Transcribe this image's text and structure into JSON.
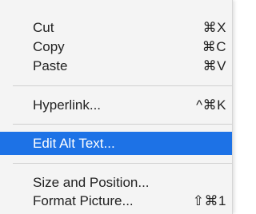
{
  "menu": {
    "items": [
      {
        "label": "Cut",
        "shortcut": "⌘X"
      },
      {
        "label": "Copy",
        "shortcut": "⌘C"
      },
      {
        "label": "Paste",
        "shortcut": "⌘V"
      },
      {
        "label": "Hyperlink...",
        "shortcut": "^⌘K"
      },
      {
        "label": "Edit Alt Text...",
        "shortcut": ""
      },
      {
        "label": "Size and Position...",
        "shortcut": ""
      },
      {
        "label": "Format Picture...",
        "shortcut": "⇧⌘1"
      }
    ],
    "highlighted_item": "Edit Alt Text...",
    "highlight_color": "#1d72e6"
  }
}
